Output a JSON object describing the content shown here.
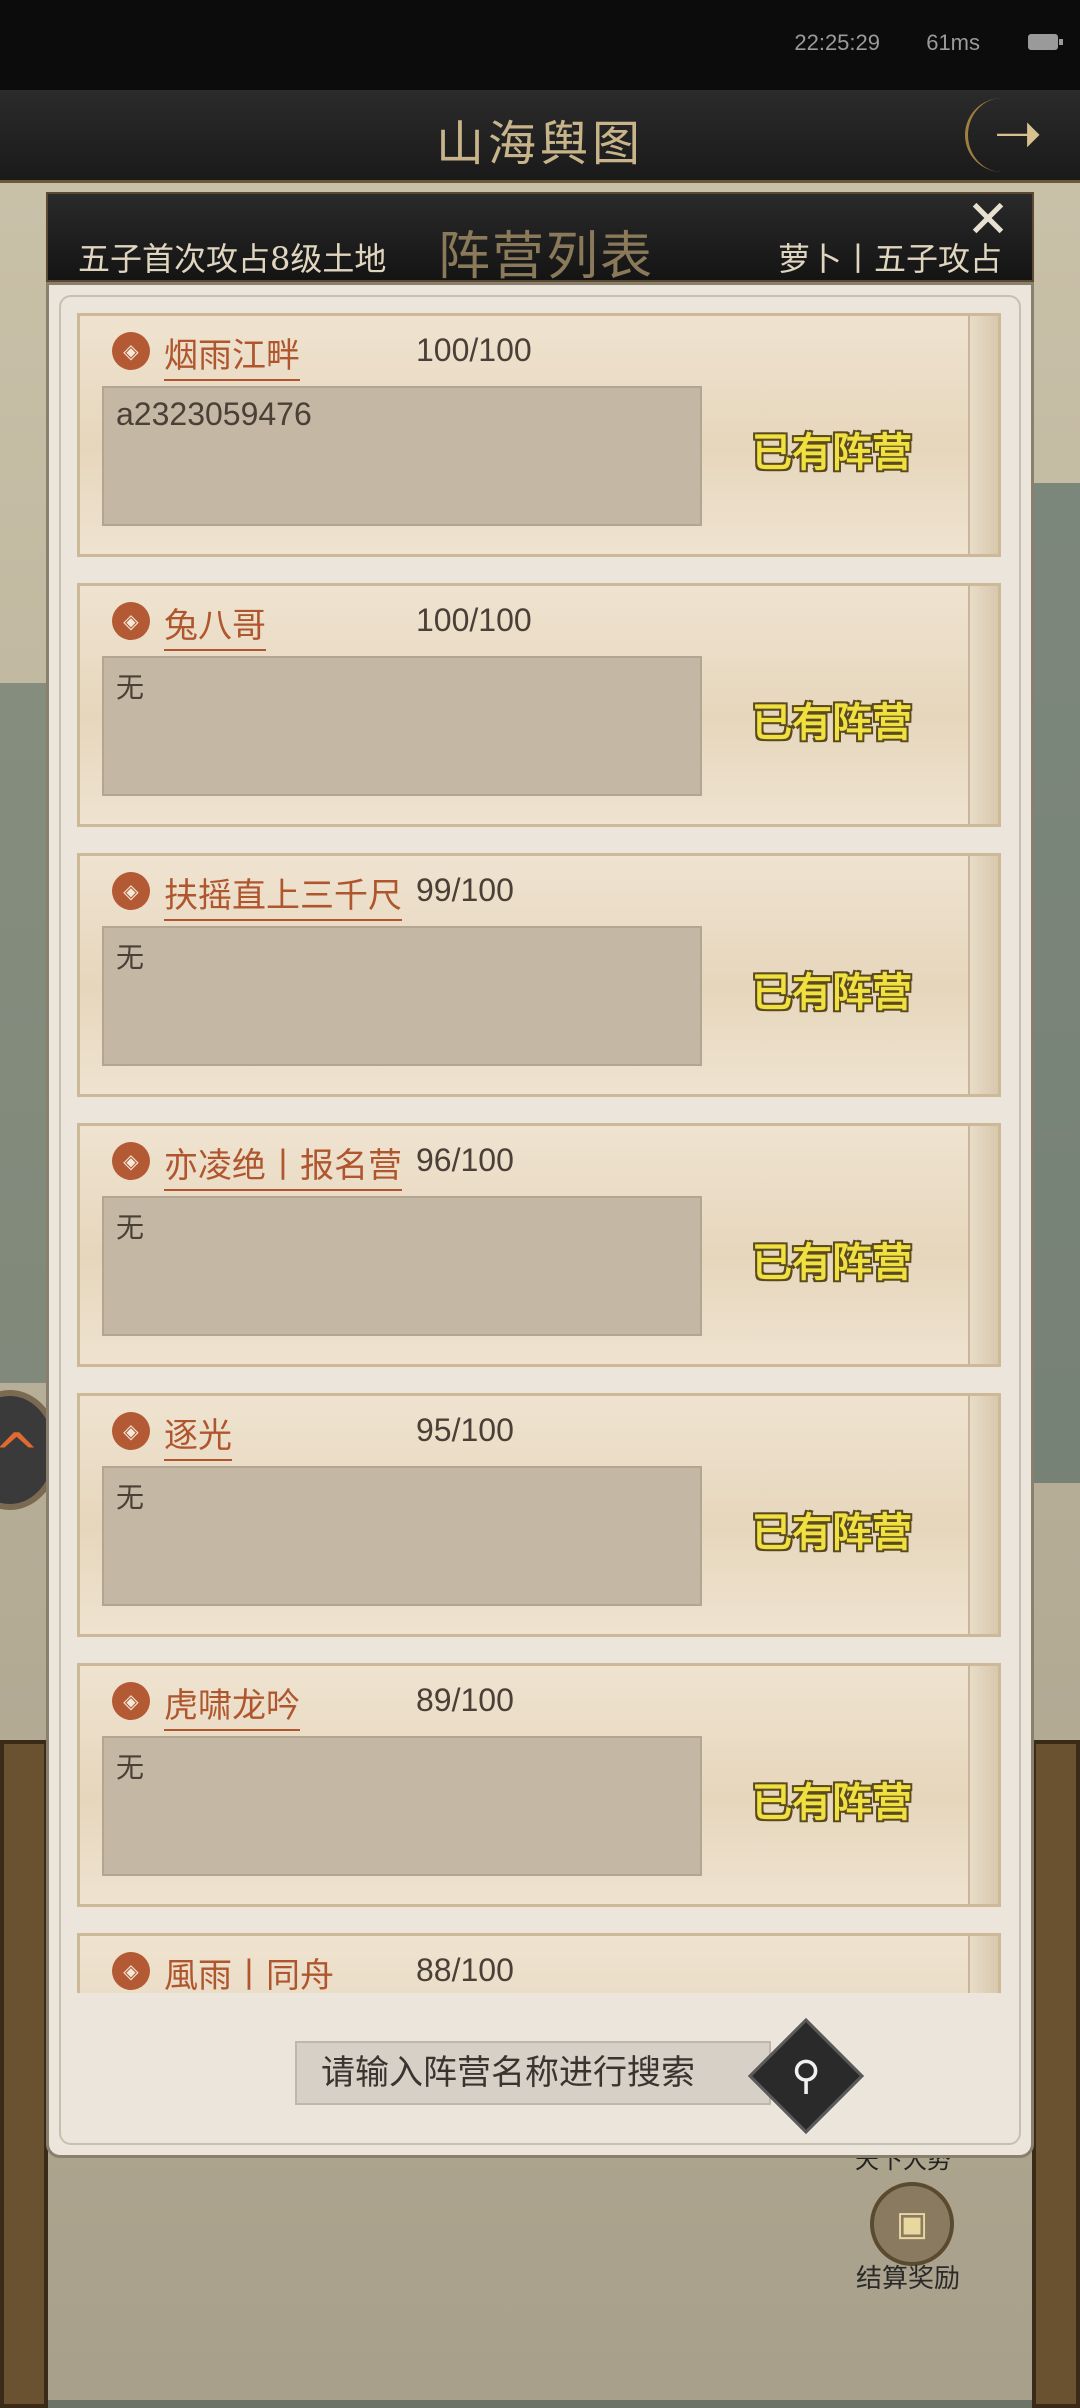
{
  "status_bar": {
    "time": "22:25:29",
    "ping": "61ms"
  },
  "title_bar": {
    "title": "山海舆图",
    "next_icon": "arrow-right-icon"
  },
  "dialog": {
    "header_left": "五子首次攻占8级土地",
    "header_title": "阵营列表",
    "header_right": "萝卜丨五子攻占",
    "close_icon": "close-icon",
    "factions": [
      {
        "name": "烟雨江畔",
        "members": "100/100",
        "description": "a2323059476",
        "status": "已有阵营"
      },
      {
        "name": "兔八哥",
        "members": "100/100",
        "description": "无",
        "status": "已有阵营"
      },
      {
        "name": "扶摇直上三千尺",
        "members": "99/100",
        "description": "无",
        "status": "已有阵营"
      },
      {
        "name": "亦凌绝丨报名营",
        "members": "96/100",
        "description": "无",
        "status": "已有阵营"
      },
      {
        "name": "逐光",
        "members": "95/100",
        "description": "无",
        "status": "已有阵营"
      },
      {
        "name": "虎啸龙吟",
        "members": "89/100",
        "description": "无",
        "status": "已有阵营"
      },
      {
        "name": "風雨丨同舟",
        "members": "88/100",
        "description": "",
        "status": ""
      }
    ],
    "search_placeholder": "请输入阵营名称进行搜索",
    "search_icon": "search-icon"
  },
  "background": {
    "tianxia_label": "天下大势",
    "reward_label": "结算奖励"
  },
  "colors": {
    "faction_name": "#b0562e",
    "status_text": "#f0e040",
    "panel_bg": "#ebe5dc"
  }
}
